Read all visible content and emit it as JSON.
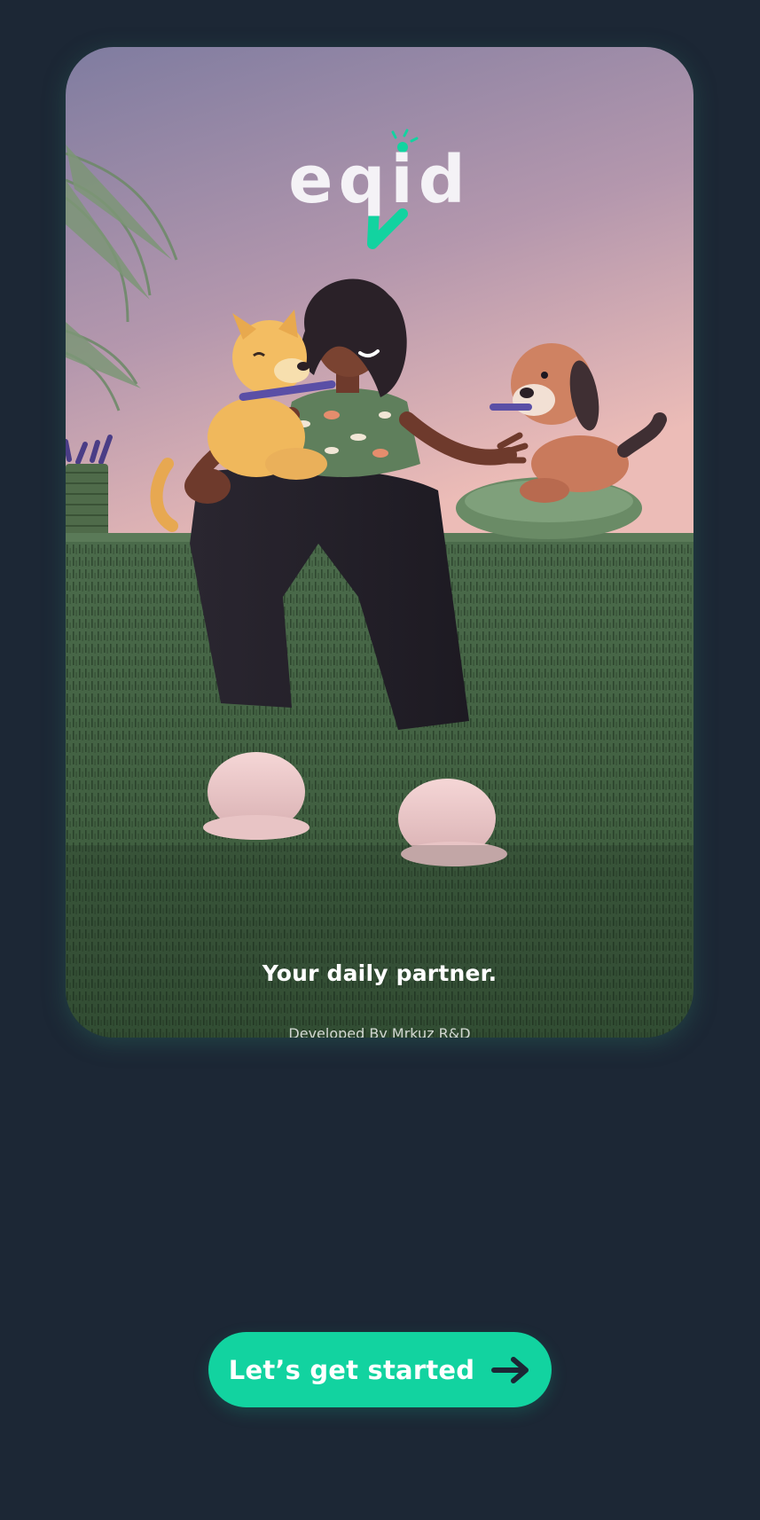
{
  "brand": {
    "logo_text": "eqid"
  },
  "hero": {
    "illustration": "woman-with-two-dogs-on-sofa",
    "tagline": "Your daily partner.",
    "credit": "Developed By Mrkuz R&D"
  },
  "cta": {
    "label": "Let’s get started",
    "icon": "arrow-right-icon"
  },
  "colors": {
    "background": "#1c2735",
    "accent": "#12d3a0",
    "sky_top": "#7c7b9c",
    "sky_bottom": "#e4b6b4",
    "sofa": "#3e5a40"
  }
}
